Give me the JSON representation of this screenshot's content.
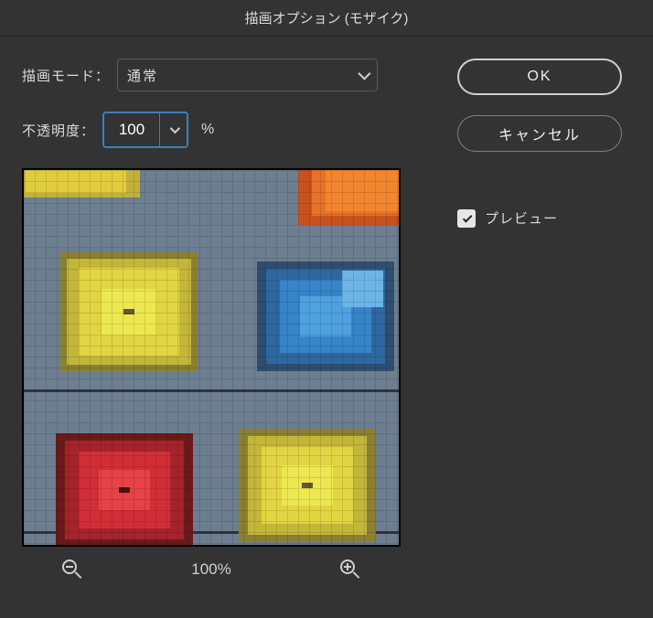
{
  "dialog": {
    "title": "描画オプション (モザイク)"
  },
  "controls": {
    "blend_mode_label": "描画モード：",
    "blend_mode_value": "通常",
    "opacity_label": "不透明度：",
    "opacity_value": "100",
    "opacity_unit": "%"
  },
  "zoom": {
    "level": "100%"
  },
  "buttons": {
    "ok": "OK",
    "cancel": "キャンセル"
  },
  "preview_checkbox": {
    "label": "プレビュー",
    "checked": true
  },
  "preview_image": {
    "description": "Pixelated mosaic preview of umbrellas (yellow, blue, red, orange) against a gray-blue sky with two horizontal wires."
  }
}
